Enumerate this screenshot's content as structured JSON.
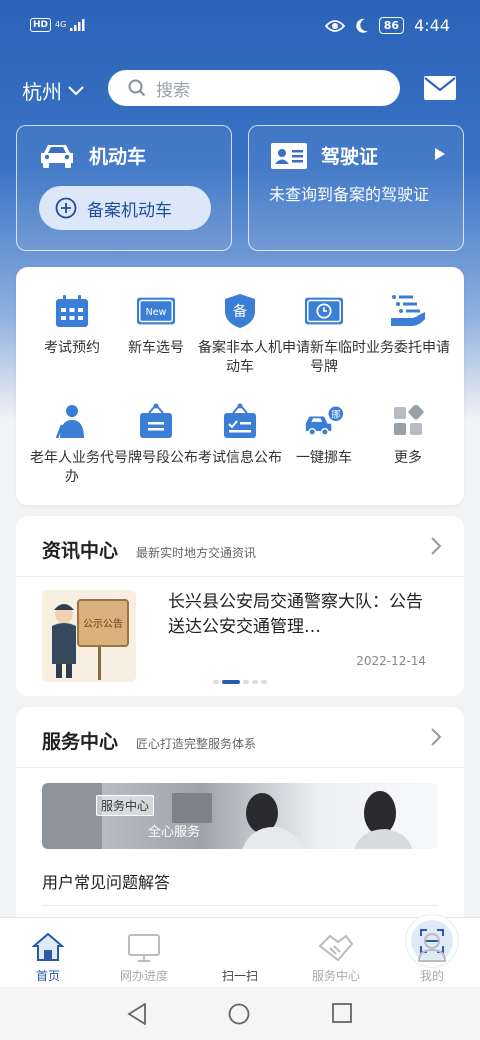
{
  "status_bar": {
    "hd": "HD",
    "network": "4G",
    "battery": "86",
    "time": "4:44"
  },
  "top_bar": {
    "city": "杭州",
    "search_placeholder": "搜索"
  },
  "motor_card": {
    "title": "机动车",
    "register_button": "备案机动车"
  },
  "license_card": {
    "title": "驾驶证",
    "description": "未查询到备案的驾驶证"
  },
  "functions": [
    {
      "label": "考试预约",
      "icon": "calendar-icon"
    },
    {
      "label": "新车选号",
      "icon": "new-plate-icon",
      "badge": "New"
    },
    {
      "label": "备案非本人机动车",
      "icon": "shield-icon",
      "badge": "备"
    },
    {
      "label": "申请新车临时号牌",
      "icon": "temp-plate-icon"
    },
    {
      "label": "业务委托申请",
      "icon": "hand-list-icon"
    },
    {
      "label": "老年人业务代办",
      "icon": "elderly-icon"
    },
    {
      "label": "号牌号段公布",
      "icon": "sign-icon"
    },
    {
      "label": "考试信息公布",
      "icon": "checklist-sign-icon"
    },
    {
      "label": "一键挪车",
      "icon": "tow-truck-icon",
      "badge": "挪"
    },
    {
      "label": "更多",
      "icon": "more-icon"
    }
  ],
  "news": {
    "title": "资讯中心",
    "subtitle": "最新实时地方交通资讯",
    "item_title": "长兴县公安局交通警察大队：公告送达公安交通管理…",
    "item_date": "2022-12-14",
    "thumb_sign": "公示公告",
    "slides": 5,
    "active_slide": 2
  },
  "service": {
    "title": "服务中心",
    "subtitle": "匠心打造完整服务体系",
    "banner_badge": "服务中心",
    "banner_text": "全心服务",
    "faq": "用户常见问题解答"
  },
  "tabs": [
    {
      "label": "首页",
      "active": true
    },
    {
      "label": "网办进度",
      "active": false
    },
    {
      "label": "扫一扫",
      "active": false
    },
    {
      "label": "服务中心",
      "active": false
    },
    {
      "label": "我的",
      "active": false
    }
  ],
  "colors": {
    "brand_blue": "#2b63b8",
    "icon_blue": "#3a7fd5",
    "active_tab": "#2a5aa8"
  }
}
